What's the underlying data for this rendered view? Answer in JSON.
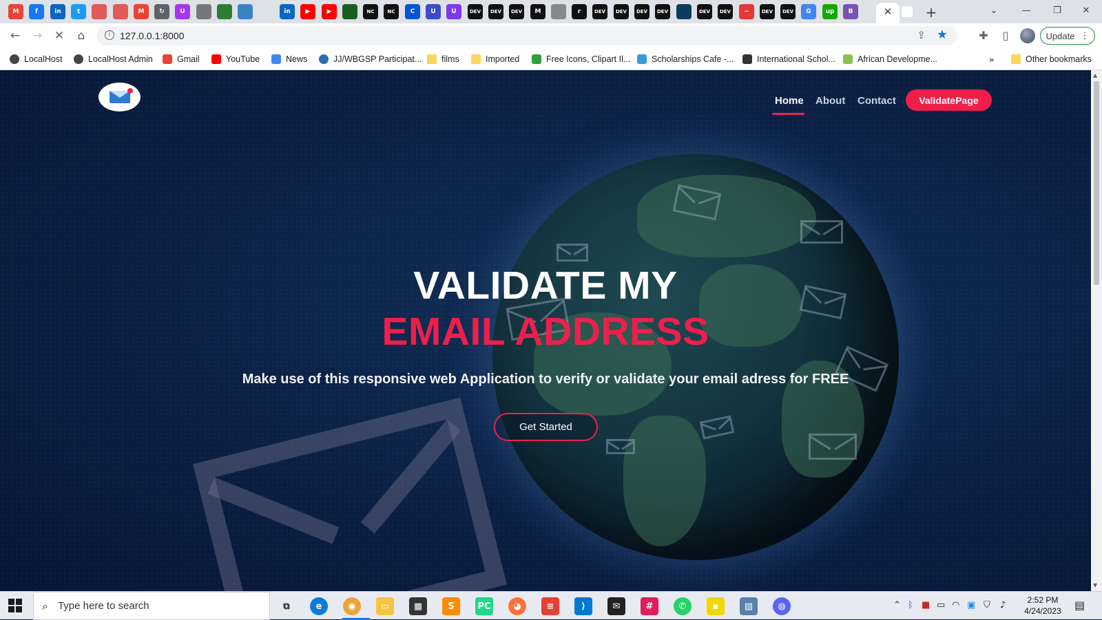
{
  "browser": {
    "address": "127.0.0.1:8000",
    "update_label": "Update",
    "window_controls": [
      "chevron-down",
      "minimize",
      "restore",
      "close"
    ],
    "tab_favicons": [
      {
        "name": "gmail-icon",
        "color": "#ea4335",
        "glyph": "M"
      },
      {
        "name": "facebook-icon",
        "color": "#1877f2",
        "glyph": "f"
      },
      {
        "name": "linkedin-icon",
        "color": "#0a66c2",
        "glyph": "in"
      },
      {
        "name": "twitter-icon",
        "color": "#1d9bf0",
        "glyph": "t"
      },
      {
        "name": "generic-red-icon",
        "color": "#e05a5a",
        "glyph": ""
      },
      {
        "name": "generic-red-icon",
        "color": "#e05a5a",
        "glyph": ""
      },
      {
        "name": "gmail-icon",
        "color": "#ea4335",
        "glyph": "M"
      },
      {
        "name": "refresh-icon",
        "color": "#5f6368",
        "glyph": "↻"
      },
      {
        "name": "udemy-icon",
        "color": "#a435f0",
        "glyph": "U"
      },
      {
        "name": "globe-icon",
        "color": "#777777",
        "glyph": ""
      },
      {
        "name": "cloud-icon",
        "color": "#2e7d32",
        "glyph": ""
      },
      {
        "name": "globe-icon",
        "color": "#3b82c4",
        "glyph": ""
      },
      {
        "name": "blank-icon",
        "color": "#dee1e6",
        "glyph": ""
      },
      {
        "name": "linkedin-icon",
        "color": "#0a66c2",
        "glyph": "in"
      },
      {
        "name": "youtube-icon",
        "color": "#ff0000",
        "glyph": "▶"
      },
      {
        "name": "youtube-icon",
        "color": "#ff0000",
        "glyph": "▶"
      },
      {
        "name": "chart-icon",
        "color": "#1b5e20",
        "glyph": ""
      },
      {
        "name": "nc-icon",
        "color": "#111111",
        "glyph": "NC"
      },
      {
        "name": "nc-icon",
        "color": "#111111",
        "glyph": "NC"
      },
      {
        "name": "coursera-icon",
        "color": "#0056d2",
        "glyph": "C"
      },
      {
        "name": "u-icon",
        "color": "#3b4cca",
        "glyph": "U"
      },
      {
        "name": "u-icon",
        "color": "#7c3aed",
        "glyph": "U"
      },
      {
        "name": "dev-icon",
        "color": "#111111",
        "glyph": "DEV"
      },
      {
        "name": "dev-icon",
        "color": "#111111",
        "glyph": "DEV"
      },
      {
        "name": "dev-icon",
        "color": "#111111",
        "glyph": "DEV"
      },
      {
        "name": "medium-icon",
        "color": "#111111",
        "glyph": "M"
      },
      {
        "name": "globe-icon",
        "color": "#888888",
        "glyph": ""
      },
      {
        "name": "r-icon",
        "color": "#111111",
        "glyph": "r"
      },
      {
        "name": "dev-icon",
        "color": "#111111",
        "glyph": "DEV"
      },
      {
        "name": "dev-icon",
        "color": "#111111",
        "glyph": "DEV"
      },
      {
        "name": "dev-icon",
        "color": "#111111",
        "glyph": "DEV"
      },
      {
        "name": "dev-icon",
        "color": "#111111",
        "glyph": "DEV"
      },
      {
        "name": "circle-icon",
        "color": "#0b3c5d",
        "glyph": ""
      },
      {
        "name": "dev-icon",
        "color": "#111111",
        "glyph": "DEV"
      },
      {
        "name": "dev-icon",
        "color": "#111111",
        "glyph": "DEV"
      },
      {
        "name": "wave-icon",
        "color": "#e53935",
        "glyph": "~"
      },
      {
        "name": "dev-icon",
        "color": "#111111",
        "glyph": "DEV"
      },
      {
        "name": "dev-icon",
        "color": "#111111",
        "glyph": "DEV"
      },
      {
        "name": "google-icon",
        "color": "#4285f4",
        "glyph": "G"
      },
      {
        "name": "upwork-icon",
        "color": "#14a800",
        "glyph": "up"
      },
      {
        "name": "bootstrap-icon",
        "color": "#7952b3",
        "glyph": "B"
      }
    ],
    "bookmarks": [
      {
        "label": "LocalHost",
        "icon": "globe-icon",
        "color": "#444444"
      },
      {
        "label": "LocalHost Admin",
        "icon": "globe-icon",
        "color": "#444444"
      },
      {
        "label": "Gmail",
        "icon": "gmail-icon",
        "color": "#ea4335"
      },
      {
        "label": "YouTube",
        "icon": "youtube-icon",
        "color": "#ff0000"
      },
      {
        "label": "News",
        "icon": "news-icon",
        "color": "#4285f4"
      },
      {
        "label": "JJ/WBGSP Participat...",
        "icon": "globe-icon",
        "color": "#2b6cb0"
      },
      {
        "label": "films",
        "icon": "folder-icon",
        "color": "#f9d65c"
      },
      {
        "label": "Imported",
        "icon": "folder-icon",
        "color": "#f9d65c"
      },
      {
        "label": "Free Icons, Clipart Il...",
        "icon": "clipart-icon",
        "color": "#2e9e3e"
      },
      {
        "label": "Scholarships Cafe -...",
        "icon": "cap-icon",
        "color": "#3a9ad9"
      },
      {
        "label": "International Schol...",
        "icon": "scholar-icon",
        "color": "#333333"
      },
      {
        "label": "African Developme...",
        "icon": "afdb-icon",
        "color": "#8bc34a"
      }
    ],
    "bookmarks_overflow": "»",
    "other_bookmarks": "Other bookmarks"
  },
  "site": {
    "nav": {
      "home": "Home",
      "about": "About",
      "contact": "Contact",
      "validate": "ValidatePage"
    },
    "hero": {
      "line1": "VALIDATE MY",
      "line2": "EMAIL ADDRESS",
      "subtitle": "Make use of this responsive web Application to verify or validate your email adress for FREE",
      "cta": "Get Started"
    },
    "colors": {
      "accent": "#ee1f4c",
      "background": "#0a1a3a"
    }
  },
  "taskbar": {
    "search_placeholder": "Type here to search",
    "apps": [
      {
        "name": "task-view-icon",
        "color": "#e7eaf1",
        "glyph": "⧉"
      },
      {
        "name": "edge-icon",
        "color": "#0f7bd6",
        "glyph": "e"
      },
      {
        "name": "chrome-icon",
        "color": "#e8a53a",
        "glyph": "◉"
      },
      {
        "name": "file-explorer-icon",
        "color": "#f4c542",
        "glyph": "▭"
      },
      {
        "name": "store-icon",
        "color": "#333333",
        "glyph": "▦"
      },
      {
        "name": "sublime-icon",
        "color": "#ff8a00",
        "glyph": "S"
      },
      {
        "name": "pycharm-icon",
        "color": "#21d789",
        "glyph": "PC"
      },
      {
        "name": "firefox-icon",
        "color": "#ff7139",
        "glyph": "◕"
      },
      {
        "name": "todoist-icon",
        "color": "#e44332",
        "glyph": "≡"
      },
      {
        "name": "vscode-icon",
        "color": "#0078d4",
        "glyph": "⟩"
      },
      {
        "name": "mail-icon",
        "color": "#222222",
        "glyph": "✉"
      },
      {
        "name": "slack-icon",
        "color": "#e01e5a",
        "glyph": "#"
      },
      {
        "name": "whatsapp-icon",
        "color": "#25d366",
        "glyph": "✆"
      },
      {
        "name": "sticky-notes-icon",
        "color": "#f2d600",
        "glyph": "▪"
      },
      {
        "name": "photos-icon",
        "color": "#5b7fa8",
        "glyph": "▨"
      },
      {
        "name": "discord-icon",
        "color": "#5865f2",
        "glyph": "◍"
      }
    ],
    "time": "2:52 PM",
    "date": "4/24/2023"
  }
}
